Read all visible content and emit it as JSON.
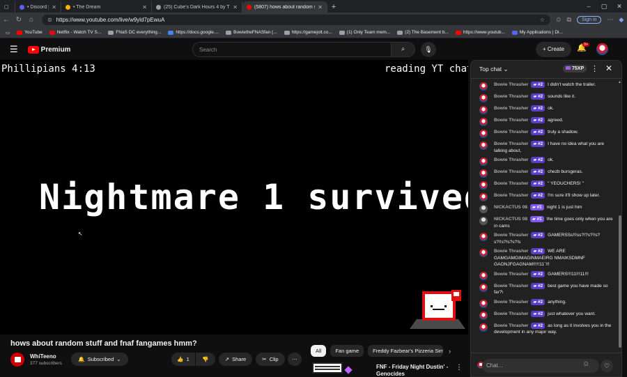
{
  "browser": {
    "tabs": [
      {
        "label": "• Discord | #quotes |",
        "icon_color": "#5865f2"
      },
      {
        "label": "• The Dream",
        "icon_color": "#f4b400"
      },
      {
        "label": "(25) Cube's Dark Hours 4 by That",
        "icon_color": "#9aa0a6"
      },
      {
        "label": "(5807) hows about random stuff",
        "icon_color": "#ff0000"
      }
    ],
    "active_tab": 3,
    "url": "https://www.youtube.com/live/w9yld7pEwuA",
    "signin_label": "Sign in",
    "bookmarks": [
      {
        "label": "YouTube",
        "color": "#ff0000"
      },
      {
        "label": "Netflix - Watch TV S...",
        "color": "#e50914"
      },
      {
        "label": "FNaS DC everything...",
        "color": "#9aa0a6"
      },
      {
        "label": "https://docs.google....",
        "color": "#4285f4"
      },
      {
        "label": "BowietheFNASfan (...",
        "color": "#9aa0a6"
      },
      {
        "label": "https://gamejolt.co...",
        "color": "#9aa0a6"
      },
      {
        "label": "(1) Only Team mem...",
        "color": "#9aa0a6"
      },
      {
        "label": "(2) The Basement b...",
        "color": "#9aa0a6"
      },
      {
        "label": "https://www.youtub...",
        "color": "#ff0000"
      },
      {
        "label": "My Applications | Di...",
        "color": "#5865f2"
      }
    ]
  },
  "youtube": {
    "logo_label": "Premium",
    "search_placeholder": "Search",
    "create_label": "Create",
    "notif_count": "9+"
  },
  "video": {
    "top_left_text": "Phillipians 4:13",
    "top_right_text": "reading YT chat still",
    "main_text": "Nightmare 1 survived"
  },
  "info": {
    "title": "hows about random stuff and fnaf fangames hmm?",
    "channel": "WhiTeeno",
    "subscribers": "377 subscribers",
    "subscribed_label": "Subscribed",
    "like_count": "1",
    "share_label": "Share",
    "clip_label": "Clip"
  },
  "chips": [
    "All",
    "Fan game",
    "Freddy Fazbear's Pizzeria Simu"
  ],
  "recommendation": {
    "title_line1": "FNF - Friday Night Dustin' -",
    "title_line2": "Genocides"
  },
  "chat": {
    "header_title": "Top chat",
    "xp_label": "75XP",
    "input_placeholder": "Chat...",
    "messages": [
      {
        "name": "Bowie Thrasher",
        "badge": "#2",
        "text": "I didn't watch the trailer.",
        "avatar": "bowie"
      },
      {
        "name": "Bowie Thrasher",
        "badge": "#2",
        "text": "sounds like it.",
        "avatar": "bowie"
      },
      {
        "name": "Bowie Thrasher",
        "badge": "#2",
        "text": "ok.",
        "avatar": "bowie"
      },
      {
        "name": "Bowie Thrasher",
        "badge": "#2",
        "text": "agreed.",
        "avatar": "bowie"
      },
      {
        "name": "Bowie Thrasher",
        "badge": "#2",
        "text": "truly a shadow.",
        "avatar": "bowie"
      },
      {
        "name": "Bowie Thrasher",
        "badge": "#2",
        "text": "I have no idea what you are talking about,",
        "avatar": "bowie"
      },
      {
        "name": "Bowie Thrasher",
        "badge": "#2",
        "text": "ok.",
        "avatar": "bowie"
      },
      {
        "name": "Bowie Thrasher",
        "badge": "#2",
        "text": "chezb bursgeras.",
        "avatar": "bowie"
      },
      {
        "name": "Bowie Thrasher",
        "badge": "#2",
        "text": "\" YEOUCHERS! \"",
        "avatar": "bowie"
      },
      {
        "name": "Bowie Thrasher",
        "badge": "#2",
        "text": "I'm sure it'll show up later.",
        "avatar": "bowie"
      },
      {
        "name": "NICKACTUS 08",
        "badge": "#1",
        "text": "night 1 is just him",
        "avatar": "nick"
      },
      {
        "name": "NICKACTUS 08",
        "badge": "#1",
        "text": "the time goes only when you are in cams",
        "avatar": "nick"
      },
      {
        "name": "Bowie Thrasher",
        "badge": "#2",
        "text": "GAMERSSs!!!ss?!?s?!!s?s?!!s?!s?s?!s",
        "avatar": "bowie"
      },
      {
        "name": "Bowie Thrasher",
        "badge": "#2",
        "text": "WE ARE GAMGAMGIMAGINMAEIRG NMAIKSDMNF GAONJFGAGNAM!!!!!11`!!!",
        "avatar": "bowie"
      },
      {
        "name": "Bowie Thrasher",
        "badge": "#2",
        "text": "GAMERS!!!11!!!11!!!",
        "avatar": "bowie"
      },
      {
        "name": "Bowie Thrasher",
        "badge": "#2",
        "text": "best game you have made so far?\\",
        "avatar": "bowie"
      },
      {
        "name": "Bowie Thrasher",
        "badge": "#2",
        "text": "anything.",
        "avatar": "bowie"
      },
      {
        "name": "Bowie Thrasher",
        "badge": "#2",
        "text": "just whatever you want.",
        "avatar": "bowie"
      },
      {
        "name": "Bowie Thrasher",
        "badge": "#2",
        "text": "as long as it involves you in the development in any major way.",
        "avatar": "bowie"
      }
    ]
  }
}
